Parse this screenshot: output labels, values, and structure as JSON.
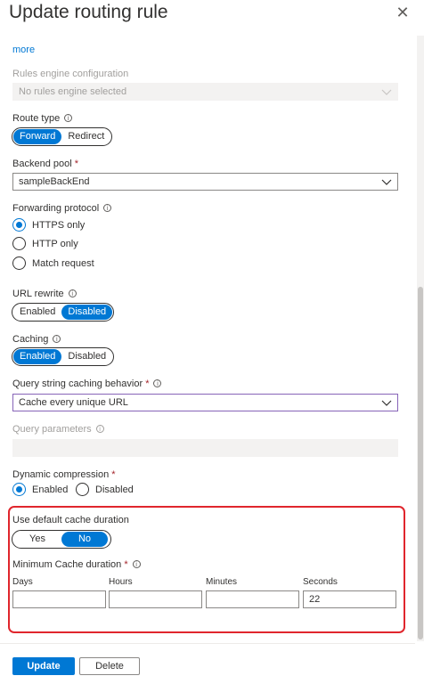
{
  "header": {
    "title": "Update routing rule",
    "close_glyph": "✕"
  },
  "more_link": "more",
  "rules_engine": {
    "label": "Rules engine configuration",
    "value": "No rules engine selected"
  },
  "route_type": {
    "label": "Route type",
    "options": [
      "Forward",
      "Redirect"
    ],
    "selected": "Forward"
  },
  "backend_pool": {
    "label": "Backend pool",
    "required_mark": "*",
    "value": "sampleBackEnd"
  },
  "forwarding_protocol": {
    "label": "Forwarding protocol",
    "options": [
      "HTTPS only",
      "HTTP only",
      "Match request"
    ],
    "selected": "HTTPS only"
  },
  "url_rewrite": {
    "label": "URL rewrite",
    "options": [
      "Enabled",
      "Disabled"
    ],
    "selected": "Disabled"
  },
  "caching": {
    "label": "Caching",
    "options": [
      "Enabled",
      "Disabled"
    ],
    "selected": "Enabled"
  },
  "query_string": {
    "label": "Query string caching behavior",
    "required_mark": "*",
    "value": "Cache every unique URL"
  },
  "query_params": {
    "label": "Query parameters",
    "value": ""
  },
  "dynamic_compression": {
    "label": "Dynamic compression",
    "required_mark": "*",
    "options": [
      "Enabled",
      "Disabled"
    ],
    "selected": "Enabled"
  },
  "default_cache": {
    "label": "Use default cache duration",
    "options": [
      "Yes",
      "No"
    ],
    "selected": "No"
  },
  "min_cache": {
    "label": "Minimum Cache duration",
    "required_mark": "*",
    "columns": [
      {
        "label": "Days",
        "value": ""
      },
      {
        "label": "Hours",
        "value": ""
      },
      {
        "label": "Minutes",
        "value": ""
      },
      {
        "label": "Seconds",
        "value": "22"
      }
    ]
  },
  "footer": {
    "update_label": "Update",
    "delete_label": "Delete"
  },
  "colors": {
    "accent": "#0078d4",
    "highlight": "#e0262d",
    "required": "#a4262c"
  },
  "icons": {
    "close": "close-icon",
    "info": "info-icon",
    "chevron": "chevron-down-icon"
  }
}
